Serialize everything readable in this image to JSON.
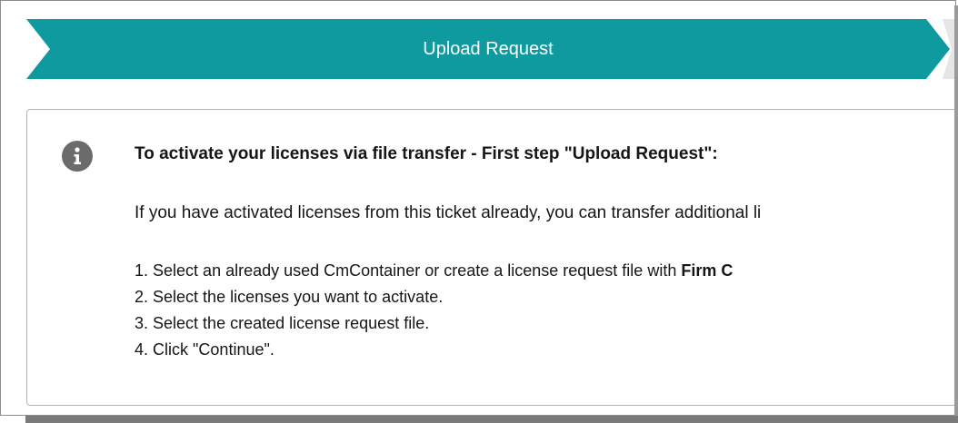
{
  "step_bar": {
    "title": "Upload Request",
    "color": "#0f9aa0"
  },
  "info_panel": {
    "icon": "info-icon",
    "heading": "To activate your licenses via file transfer - First step \"Upload Request\":",
    "intro": "If you have activated licenses from this ticket already, you can transfer additional li",
    "steps": [
      {
        "number": "1.",
        "text": "Select an already used CmContainer or create a license request file with ",
        "emphasis": "Firm C"
      },
      {
        "number": "2.",
        "text": "Select the licenses you want to activate.",
        "emphasis": ""
      },
      {
        "number": "3.",
        "text": "Select the created license request file.",
        "emphasis": ""
      },
      {
        "number": "4.",
        "text": "Click \"Continue\".",
        "emphasis": ""
      }
    ]
  }
}
